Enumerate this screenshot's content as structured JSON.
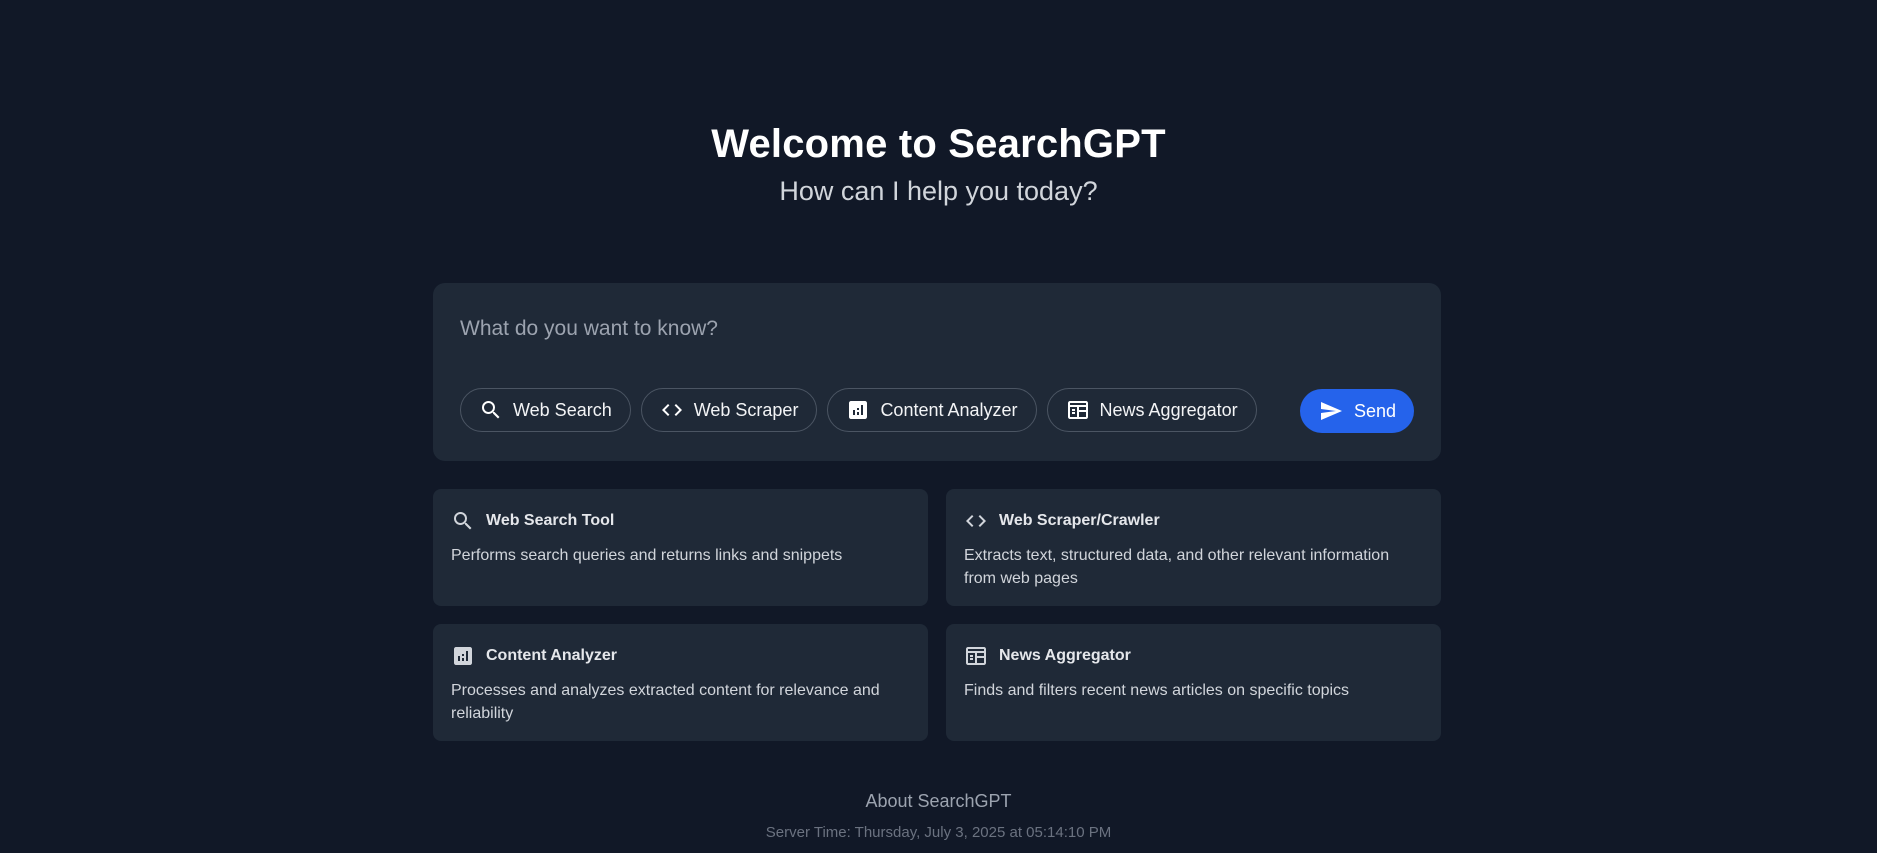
{
  "hero": {
    "title": "Welcome to SearchGPT",
    "subtitle": "How can I help you today?"
  },
  "composer": {
    "placeholder": "What do you want to know?",
    "tools": [
      {
        "label": "Web Search",
        "icon": "search-icon"
      },
      {
        "label": "Web Scraper",
        "icon": "code-icon"
      },
      {
        "label": "Content Analyzer",
        "icon": "analytics-icon"
      },
      {
        "label": "News Aggregator",
        "icon": "newspaper-icon"
      }
    ],
    "send_label": "Send",
    "send_icon": "send-icon"
  },
  "cards": [
    {
      "title": "Web Search Tool",
      "icon": "search-icon",
      "description": "Performs search queries and returns links and snippets"
    },
    {
      "title": "Web Scraper/Crawler",
      "icon": "code-icon",
      "description": "Extracts text, structured data, and other relevant information from web pages"
    },
    {
      "title": "Content Analyzer",
      "icon": "analytics-icon",
      "description": "Processes and analyzes extracted content for relevance and reliability"
    },
    {
      "title": "News Aggregator",
      "icon": "newspaper-icon",
      "description": "Finds and filters recent news articles on specific topics"
    }
  ],
  "footer": {
    "about_label": "About SearchGPT",
    "server_time": "Server Time: Thursday, July 3, 2025 at 05:14:10 PM"
  },
  "colors": {
    "background": "#111827",
    "panel": "#1f2937",
    "accent": "#2563eb",
    "chip_border": "#4b5563"
  }
}
